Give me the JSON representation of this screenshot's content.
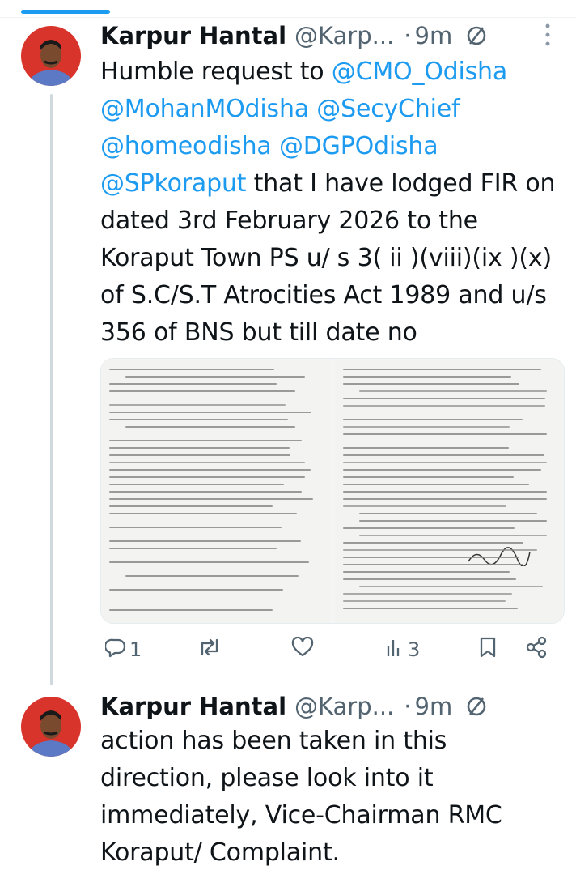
{
  "colors": {
    "accent": "#1d9bf0",
    "muted": "#536471",
    "text": "#0f1419",
    "thread_line": "#cfd9de"
  },
  "tweets": [
    {
      "author_name": "Karpur Hantal",
      "author_handle": "@Karp...",
      "separator": "·",
      "time": "9m",
      "status_icon": "nope-icon",
      "more_icon": "more-vertical-icon",
      "segments": [
        {
          "text": "Humble request to ",
          "type": "text"
        },
        {
          "text": "@CMO_Odisha",
          "type": "mention"
        },
        {
          "text": " ",
          "type": "text"
        },
        {
          "text": "@MohanMOdisha",
          "type": "mention"
        },
        {
          "text": " ",
          "type": "text"
        },
        {
          "text": "@SecyChief",
          "type": "mention"
        },
        {
          "text": " ",
          "type": "text"
        },
        {
          "text": "@homeodisha",
          "type": "mention"
        },
        {
          "text": " ",
          "type": "text"
        },
        {
          "text": "@DGPOdisha",
          "type": "mention"
        },
        {
          "text": " ",
          "type": "text"
        },
        {
          "text": "@SPkoraput",
          "type": "mention"
        },
        {
          "text": " that I have lodged FIR on dated 3rd February 2026 to the Koraput Town PS u/ s 3( ii )(viii)(ix )(x) of S.C/S.T Atrocities Act 1989 and u/s 356 of BNS but till date no",
          "type": "text"
        }
      ],
      "media": {
        "images": [
          "document-page-1",
          "document-page-2"
        ]
      },
      "actions": {
        "reply_count": "1",
        "retweet_count": "",
        "like_count": "",
        "views_count": "3"
      }
    },
    {
      "author_name": "Karpur Hantal",
      "author_handle": "@Karp...",
      "separator": "·",
      "time": "9m",
      "status_icon": "nope-icon",
      "text": "action has been taken in this direction, please look into it immediately, Vice-Chairman RMC Koraput/ Complaint."
    }
  ]
}
